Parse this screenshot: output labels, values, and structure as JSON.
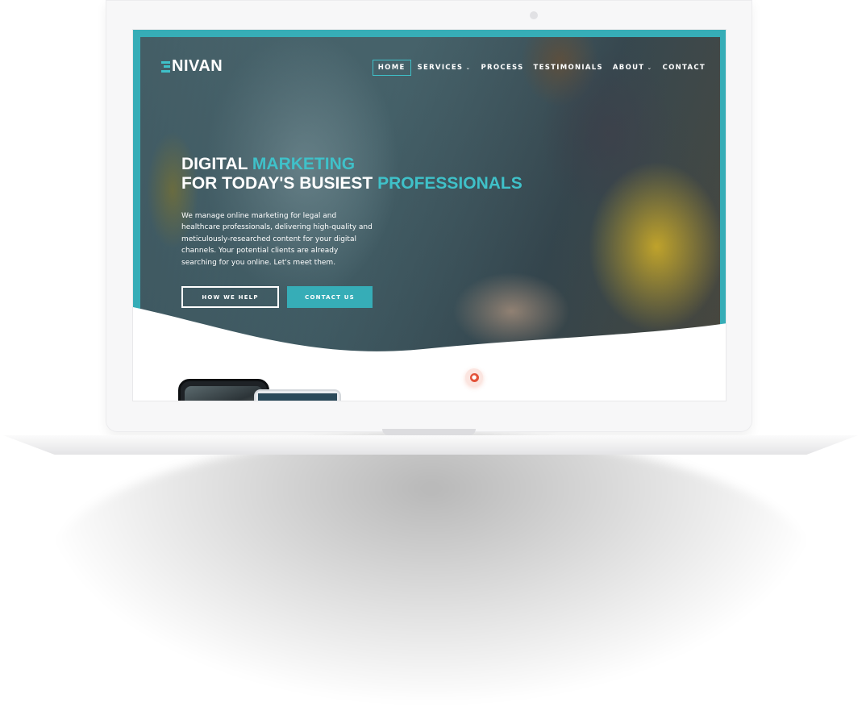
{
  "site": {
    "logo_text": "NIVAN",
    "colors": {
      "accent": "#3fc1c9",
      "brand_teal": "#36adb7",
      "white": "#ffffff"
    }
  },
  "nav": {
    "items": [
      {
        "label": "HOME",
        "active": true,
        "has_dropdown": false
      },
      {
        "label": "SERVICES",
        "active": false,
        "has_dropdown": true
      },
      {
        "label": "PROCESS",
        "active": false,
        "has_dropdown": false
      },
      {
        "label": "TESTIMONIALS",
        "active": false,
        "has_dropdown": false
      },
      {
        "label": "ABOUT",
        "active": false,
        "has_dropdown": true
      },
      {
        "label": "CONTACT",
        "active": false,
        "has_dropdown": false
      }
    ],
    "dropdown_icon": "chevron-down-icon"
  },
  "hero": {
    "headline_line1_white": "DIGITAL",
    "headline_line1_accent": "MARKETING",
    "headline_line2_white": "FOR TODAY'S BUSIEST",
    "headline_line2_accent": "PROFESSIONALS",
    "lead": "We manage online marketing for legal and healthcare professionals, delivering high-quality and meticulously-researched content for your digital channels. Your potential clients are already searching for you online. Let's meet them.",
    "buttons": {
      "primary_outline": "HOW WE HELP",
      "secondary_solid": "CONTACT US"
    }
  },
  "widgets": {
    "chat_icon": "chat-bubble-icon"
  }
}
